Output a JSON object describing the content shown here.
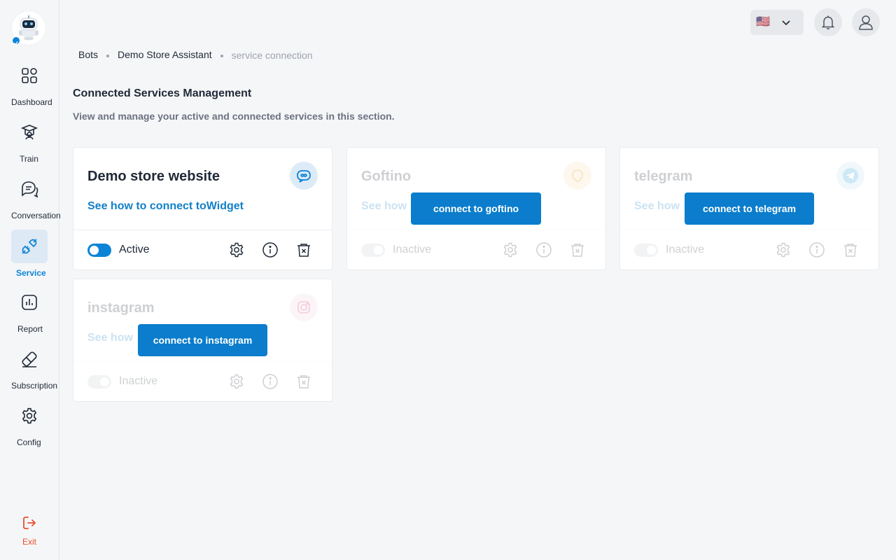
{
  "sidebar": {
    "items": [
      {
        "label": "Dashboard",
        "icon": "dashboard-icon"
      },
      {
        "label": "Train",
        "icon": "train-icon"
      },
      {
        "label": "Conversation",
        "icon": "conversation-icon"
      },
      {
        "label": "Service",
        "icon": "service-icon",
        "active": true
      },
      {
        "label": "Report",
        "icon": "report-icon"
      },
      {
        "label": "Subscription",
        "icon": "subscription-icon"
      },
      {
        "label": "Config",
        "icon": "gear-icon"
      }
    ],
    "exit_label": "Exit"
  },
  "header": {
    "language_flag": "🇺🇸"
  },
  "breadcrumb": [
    "Bots",
    "Demo Store Assistant",
    "service connection"
  ],
  "page": {
    "title": "Connected Services Management",
    "subtitle": "View and manage your active and connected services in this section."
  },
  "services": [
    {
      "name": "Demo store website",
      "link": "See how to connect toWidget",
      "status": "Active",
      "enabled": true,
      "icon": "widget-icon",
      "connect_label": ""
    },
    {
      "name": "Goftino",
      "link": "See how",
      "status": "Inactive",
      "enabled": false,
      "icon": "goftino-icon",
      "connect_label": "connect to goftino"
    },
    {
      "name": "telegram",
      "link": "See how",
      "status": "Inactive",
      "enabled": false,
      "icon": "telegram-icon",
      "connect_label": "connect to telegram"
    },
    {
      "name": "instagram",
      "link": "See how",
      "status": "Inactive",
      "enabled": false,
      "icon": "instagram-icon",
      "connect_label": "connect to instagram"
    }
  ],
  "colors": {
    "accent": "#0b84d8",
    "exit": "#e8502e"
  }
}
